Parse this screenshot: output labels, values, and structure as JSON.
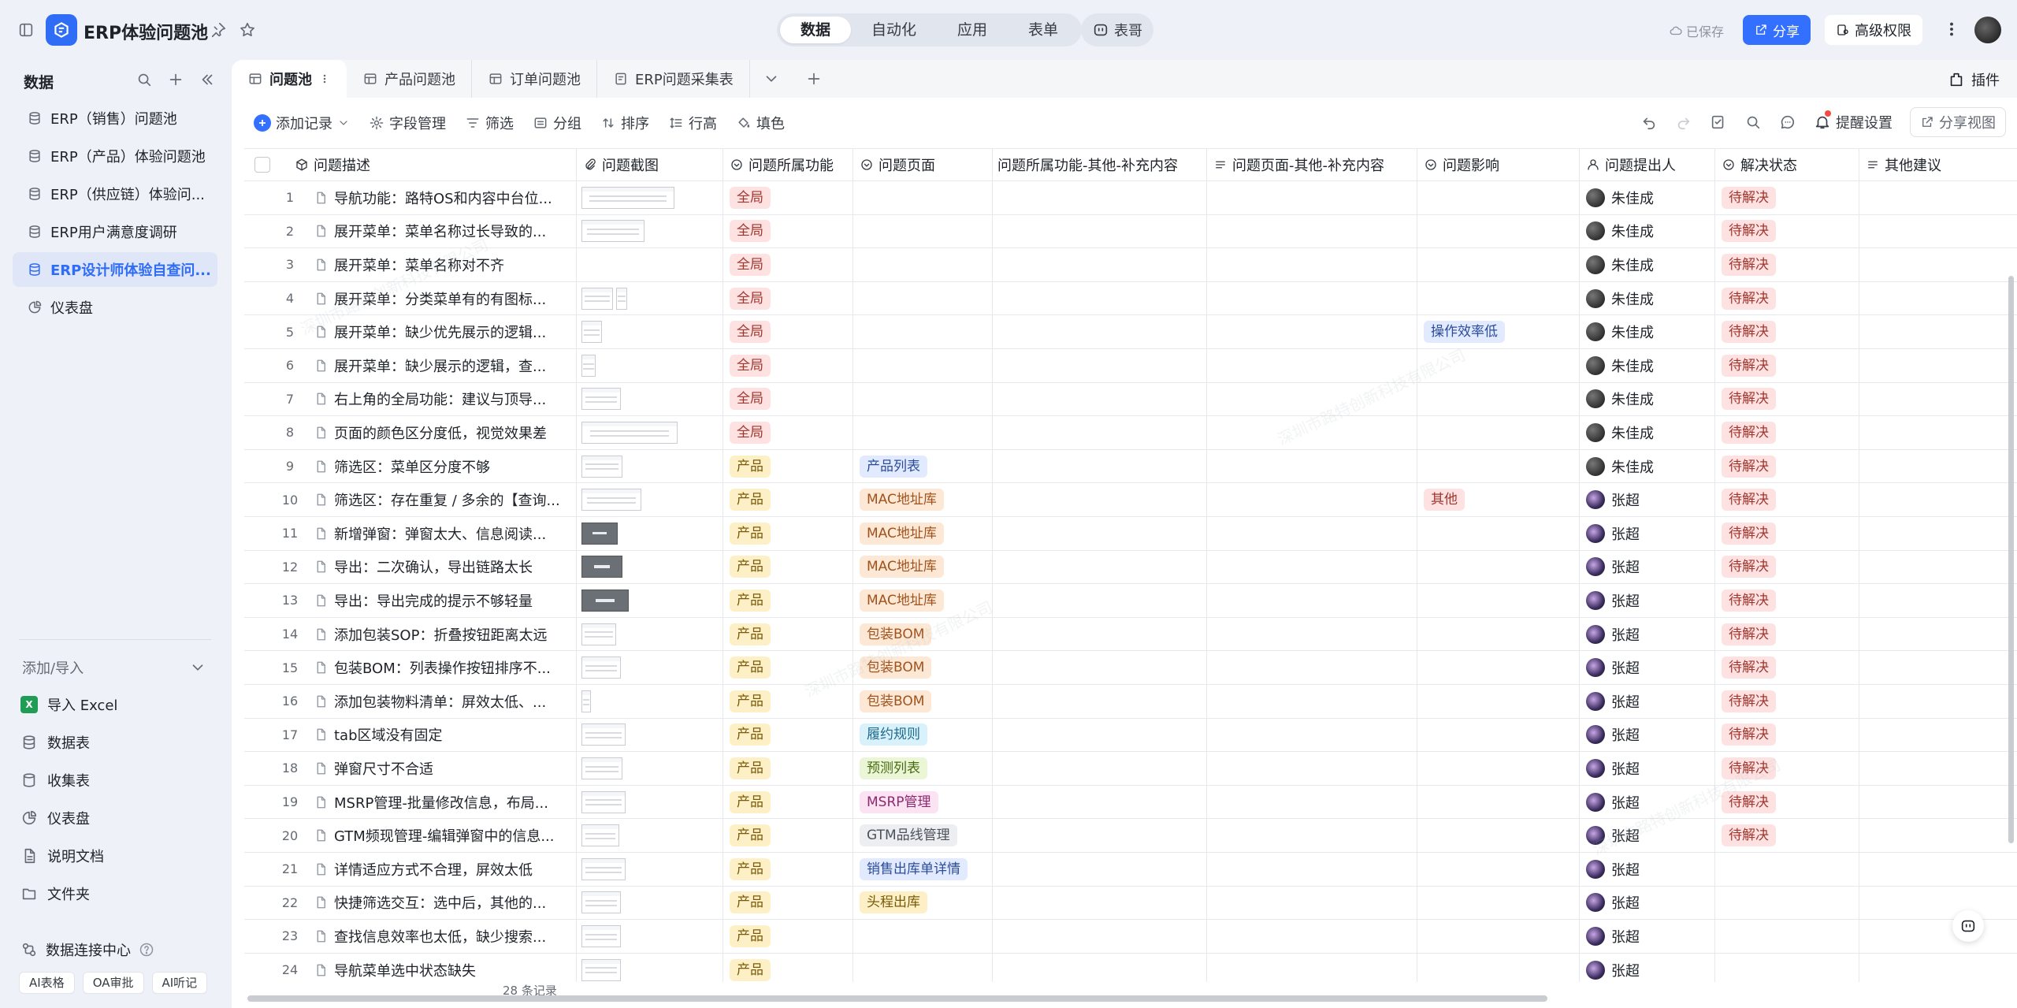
{
  "topbar": {
    "title": "ERP体验问题池",
    "modes": [
      "数据",
      "自动化",
      "应用",
      "表单"
    ],
    "active_mode": 0,
    "bot_label": "表哥",
    "saved": "已保存",
    "share": "分享",
    "permission": "高级权限"
  },
  "sidebar": {
    "heading": "数据",
    "items": [
      {
        "label": "ERP（销售）问题池",
        "icon": "table-icon"
      },
      {
        "label": "ERP（产品）体验问题池",
        "icon": "table-icon"
      },
      {
        "label": "ERP（供应链）体验问...",
        "icon": "table-icon"
      },
      {
        "label": "ERP用户满意度调研",
        "icon": "table-icon"
      },
      {
        "label": "ERP设计师体验自查问...",
        "icon": "table-icon",
        "active": true
      },
      {
        "label": "仪表盘",
        "icon": "dashboard-icon"
      }
    ],
    "add_import": "添加/导入",
    "add_items": [
      {
        "label": "导入 Excel",
        "icon": "excel-icon"
      },
      {
        "label": "数据表",
        "icon": "table-icon"
      },
      {
        "label": "收集表",
        "icon": "form-icon"
      },
      {
        "label": "仪表盘",
        "icon": "dashboard-icon"
      },
      {
        "label": "说明文档",
        "icon": "doc-icon"
      },
      {
        "label": "文件夹",
        "icon": "folder-icon"
      }
    ],
    "connect": "数据连接中心",
    "chips": [
      "AI表格",
      "OA审批",
      "AI听记"
    ]
  },
  "tabs": [
    {
      "label": "问题池",
      "active": true
    },
    {
      "label": "产品问题池"
    },
    {
      "label": "订单问题池"
    },
    {
      "label": "ERP问题采集表"
    }
  ],
  "plugin": "插件",
  "toolbar": {
    "add_record": "添加记录",
    "fields": "字段管理",
    "filter": "筛选",
    "group": "分组",
    "sort": "排序",
    "row_height": "行高",
    "fill": "填色",
    "remind": "提醒设置",
    "share_view": "分享视图"
  },
  "columns": [
    "问题描述",
    "问题截图",
    "问题所属功能",
    "问题页面",
    "问题所属功能-其他-补充内容",
    "问题页面-其他-补充内容",
    "问题影响",
    "问题提出人",
    "解决状态",
    "其他建议"
  ],
  "colors": {
    "global": {
      "bg": "#fde2e1",
      "fg": "#a2362f"
    },
    "product": {
      "bg": "#fdf0c6",
      "fg": "#7a5a08"
    },
    "state": {
      "bg": "#fde2e1",
      "fg": "#a2362f"
    }
  },
  "page_tag_colors": {
    "产品列表": [
      "#e1eaff",
      "#2c4c9a"
    ],
    "MAC地址库": [
      "#fde8d6",
      "#a0521c"
    ],
    "包装BOM": [
      "#fde8d6",
      "#a0521c"
    ],
    "履约规则": [
      "#d9f1fb",
      "#1e6a8c"
    ],
    "预测列表": [
      "#eaf6d5",
      "#4a6a12"
    ],
    "MSRP管理": [
      "#fbe3f3",
      "#8c2a70"
    ],
    "GTM品线管理": [
      "#eceef1",
      "#4b5159"
    ],
    "销售出库单详情": [
      "#e1eaff",
      "#2c4c9a"
    ],
    "头程出库": [
      "#fdf0c6",
      "#7a5a08"
    ]
  },
  "impact_tag_colors": {
    "操作效率低": [
      "#e1eaff",
      "#2c4c9a"
    ],
    "其他": [
      "#fde2e1",
      "#a2362f"
    ]
  },
  "rows": [
    {
      "n": 1,
      "desc": "导航功能：路特OS和内容中台位...",
      "shot": [
        [
          "w",
          118
        ]
      ],
      "func": "全局",
      "page": "",
      "impact": "",
      "user": "朱佳成",
      "ua": 1,
      "state": "待解决"
    },
    {
      "n": 2,
      "desc": "展开菜单：菜单名称过长导致的...",
      "shot": [
        [
          "w",
          80
        ]
      ],
      "func": "全局",
      "page": "",
      "impact": "",
      "user": "朱佳成",
      "ua": 1,
      "state": "待解决"
    },
    {
      "n": 3,
      "desc": "展开菜单：菜单名称对不齐",
      "shot": [],
      "func": "全局",
      "page": "",
      "impact": "",
      "user": "朱佳成",
      "ua": 1,
      "state": "待解决"
    },
    {
      "n": 4,
      "desc": "展开菜单：分类菜单有的有图标...",
      "shot": [
        [
          "w",
          40
        ],
        [
          "w",
          14
        ]
      ],
      "func": "全局",
      "page": "",
      "impact": "",
      "user": "朱佳成",
      "ua": 1,
      "state": "待解决"
    },
    {
      "n": 5,
      "desc": "展开菜单：缺少优先展示的逻辑...",
      "shot": [
        [
          "w",
          26
        ]
      ],
      "func": "全局",
      "page": "",
      "impact": "操作效率低",
      "user": "朱佳成",
      "ua": 1,
      "state": "待解决"
    },
    {
      "n": 6,
      "desc": "展开菜单：缺少展示的逻辑，查...",
      "shot": [
        [
          "w",
          18
        ]
      ],
      "func": "全局",
      "page": "",
      "impact": "",
      "user": "朱佳成",
      "ua": 1,
      "state": "待解决"
    },
    {
      "n": 7,
      "desc": "右上角的全局功能：建议与顶导...",
      "shot": [
        [
          "w",
          50
        ]
      ],
      "func": "全局",
      "page": "",
      "impact": "",
      "user": "朱佳成",
      "ua": 1,
      "state": "待解决"
    },
    {
      "n": 8,
      "desc": "页面的颜色区分度低，视觉效果差",
      "shot": [
        [
          "w",
          122
        ]
      ],
      "func": "全局",
      "page": "",
      "impact": "",
      "user": "朱佳成",
      "ua": 1,
      "state": "待解决"
    },
    {
      "n": 9,
      "desc": "筛选区：菜单区分度不够",
      "shot": [
        [
          "w",
          52
        ]
      ],
      "func": "产品",
      "page": "产品列表",
      "impact": "",
      "user": "朱佳成",
      "ua": 1,
      "state": "待解决"
    },
    {
      "n": 10,
      "desc": "筛选区：存在重复 / 多余的【查询...",
      "shot": [
        [
          "w",
          76
        ]
      ],
      "func": "产品",
      "page": "MAC地址库",
      "impact": "其他",
      "user": "张超",
      "ua": 2,
      "state": "待解决"
    },
    {
      "n": 11,
      "desc": "新增弹窗：弹窗太大、信息阅读...",
      "shot": [
        [
          "d",
          46
        ]
      ],
      "func": "产品",
      "page": "MAC地址库",
      "impact": "",
      "user": "张超",
      "ua": 2,
      "state": "待解决"
    },
    {
      "n": 12,
      "desc": "导出：二次确认，导出链路太长",
      "shot": [
        [
          "d",
          52
        ]
      ],
      "func": "产品",
      "page": "MAC地址库",
      "impact": "",
      "user": "张超",
      "ua": 2,
      "state": "待解决"
    },
    {
      "n": 13,
      "desc": "导出：导出完成的提示不够轻量",
      "shot": [
        [
          "d",
          60
        ]
      ],
      "func": "产品",
      "page": "MAC地址库",
      "impact": "",
      "user": "张超",
      "ua": 2,
      "state": "待解决"
    },
    {
      "n": 14,
      "desc": "添加包装SOP：折叠按钮距离太远",
      "shot": [
        [
          "w",
          44
        ]
      ],
      "func": "产品",
      "page": "包装BOM",
      "impact": "",
      "user": "张超",
      "ua": 2,
      "state": "待解决"
    },
    {
      "n": 15,
      "desc": "包装BOM：列表操作按钮排序不...",
      "shot": [
        [
          "w",
          50
        ]
      ],
      "func": "产品",
      "page": "包装BOM",
      "impact": "",
      "user": "张超",
      "ua": 2,
      "state": "待解决"
    },
    {
      "n": 16,
      "desc": "添加包装物料清单：屏效太低、...",
      "shot": [
        [
          "w",
          12
        ]
      ],
      "func": "产品",
      "page": "包装BOM",
      "impact": "",
      "user": "张超",
      "ua": 2,
      "state": "待解决"
    },
    {
      "n": 17,
      "desc": "tab区域没有固定",
      "shot": [
        [
          "w",
          56
        ]
      ],
      "func": "产品",
      "page": "履约规则",
      "impact": "",
      "user": "张超",
      "ua": 2,
      "state": "待解决"
    },
    {
      "n": 18,
      "desc": "弹窗尺寸不合适",
      "shot": [
        [
          "w",
          52
        ]
      ],
      "func": "产品",
      "page": "预测列表",
      "impact": "",
      "user": "张超",
      "ua": 2,
      "state": "待解决"
    },
    {
      "n": 19,
      "desc": "MSRP管理-批量修改信息，布局...",
      "shot": [
        [
          "w",
          56
        ]
      ],
      "func": "产品",
      "page": "MSRP管理",
      "impact": "",
      "user": "张超",
      "ua": 2,
      "state": "待解决"
    },
    {
      "n": 20,
      "desc": "GTM频现管理-编辑弹窗中的信息...",
      "shot": [
        [
          "w",
          48
        ]
      ],
      "func": "产品",
      "page": "GTM品线管理",
      "impact": "",
      "user": "张超",
      "ua": 2,
      "state": "待解决"
    },
    {
      "n": 21,
      "desc": "详情适应方式不合理，屏效太低",
      "shot": [
        [
          "w",
          56
        ]
      ],
      "func": "产品",
      "page": "销售出库单详情",
      "impact": "",
      "user": "张超",
      "ua": 2,
      "state": ""
    },
    {
      "n": 22,
      "desc": "快捷筛选交互：选中后，其他的...",
      "shot": [
        [
          "w",
          50
        ]
      ],
      "func": "产品",
      "page": "头程出库",
      "impact": "",
      "user": "张超",
      "ua": 2,
      "state": ""
    },
    {
      "n": 23,
      "desc": "查找信息效率也太低，缺少搜索...",
      "shot": [
        [
          "w",
          50
        ]
      ],
      "func": "产品",
      "page": "",
      "impact": "",
      "user": "张超",
      "ua": 2,
      "state": ""
    },
    {
      "n": 24,
      "desc": "导航菜单选中状态缺失",
      "shot": [
        [
          "w",
          50
        ]
      ],
      "func": "产品",
      "page": "",
      "impact": "",
      "user": "张超",
      "ua": 2,
      "state": ""
    }
  ],
  "record_count": "28 条记录"
}
